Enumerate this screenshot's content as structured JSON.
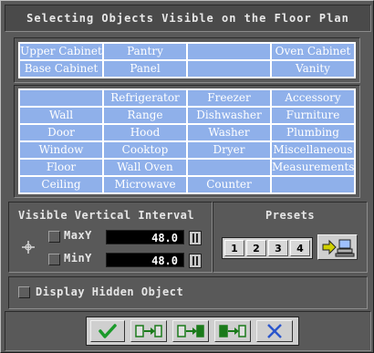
{
  "dialog": {
    "title": "Selecting Objects Visible on the Floor Plan"
  },
  "top_grid": [
    [
      "Upper Cabinet",
      "Pantry",
      "",
      "Oven Cabinet"
    ],
    [
      "Base Cabinet",
      "Panel",
      "",
      "Vanity"
    ]
  ],
  "main_grid": [
    [
      "",
      "Refrigerator",
      "Freezer",
      "Accessory"
    ],
    [
      "Wall",
      "Range",
      "Dishwasher",
      "Furniture"
    ],
    [
      "Door",
      "Hood",
      "Washer",
      "Plumbing"
    ],
    [
      "Window",
      "Cooktop",
      "Dryer",
      "Miscellaneous"
    ],
    [
      "Floor",
      "Wall Oven",
      "",
      "Measurements"
    ],
    [
      "Ceiling",
      "Microwave",
      "Counter",
      ""
    ]
  ],
  "vertical_interval": {
    "heading": "Visible Vertical Interval",
    "max_label": "MaxY",
    "max_value": "48.0",
    "min_label": "MinY",
    "min_value": "48.0"
  },
  "presets": {
    "heading": "Presets",
    "buttons": [
      "1",
      "2",
      "3",
      "4"
    ]
  },
  "display_hidden_label": "Display Hidden Object",
  "colors": {
    "cell_blue": "#8fb0ea",
    "panel_gray": "#595959",
    "ok_green": "#1a9a2a",
    "cancel_blue": "#2a55cc"
  },
  "toolbar_icons": [
    "check-icon",
    "copy-level-icon",
    "copy-all-icon",
    "paste-level-icon",
    "cancel-x-icon"
  ]
}
